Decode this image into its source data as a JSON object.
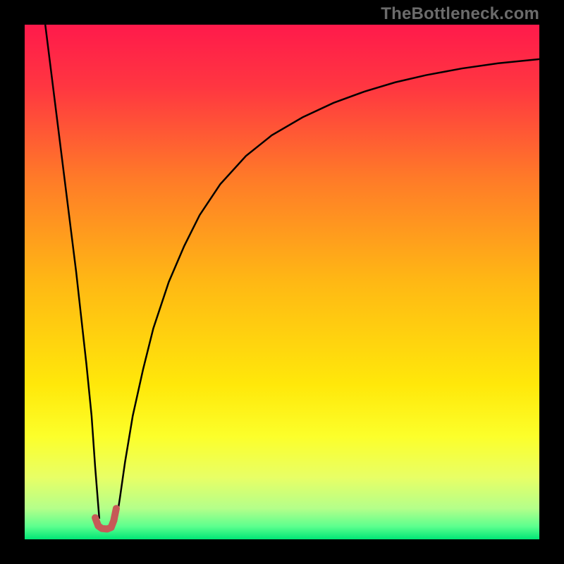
{
  "watermark": "TheBottleneck.com",
  "chart_data": {
    "type": "line",
    "title": "",
    "xlabel": "",
    "ylabel": "",
    "xlim": [
      0,
      100
    ],
    "ylim": [
      0,
      100
    ],
    "grid": false,
    "legend": false,
    "background_gradient": {
      "stops": [
        {
          "offset": 0.0,
          "color": "#ff1a4b"
        },
        {
          "offset": 0.12,
          "color": "#ff3641"
        },
        {
          "offset": 0.3,
          "color": "#ff7b28"
        },
        {
          "offset": 0.5,
          "color": "#ffb814"
        },
        {
          "offset": 0.7,
          "color": "#ffe80a"
        },
        {
          "offset": 0.8,
          "color": "#fcff2a"
        },
        {
          "offset": 0.88,
          "color": "#e8ff66"
        },
        {
          "offset": 0.94,
          "color": "#b4ff8a"
        },
        {
          "offset": 0.975,
          "color": "#5cff8e"
        },
        {
          "offset": 1.0,
          "color": "#00e676"
        }
      ]
    },
    "series": [
      {
        "name": "left-branch",
        "stroke": "#000000",
        "stroke_width": 2.5,
        "x": [
          4.0,
          5.0,
          6.0,
          7.0,
          8.0,
          9.0,
          10.0,
          11.0,
          12.0,
          13.0,
          13.7,
          14.5
        ],
        "y": [
          100.0,
          92.0,
          84.0,
          76.0,
          68.0,
          60.0,
          52.0,
          43.0,
          34.0,
          24.0,
          14.0,
          4.0
        ]
      },
      {
        "name": "right-branch",
        "stroke": "#000000",
        "stroke_width": 2.5,
        "x": [
          17.8,
          18.5,
          19.5,
          21.0,
          23.0,
          25.0,
          28.0,
          31.0,
          34.0,
          38.0,
          43.0,
          48.0,
          54.0,
          60.0,
          66.0,
          72.0,
          78.0,
          85.0,
          92.0,
          100.0
        ],
        "y": [
          3.5,
          8.0,
          15.0,
          24.0,
          33.0,
          41.0,
          50.0,
          57.0,
          63.0,
          69.0,
          74.5,
          78.5,
          82.0,
          84.8,
          87.0,
          88.8,
          90.2,
          91.5,
          92.5,
          93.3
        ]
      },
      {
        "name": "valley-marker",
        "stroke": "#c65a57",
        "stroke_width": 10,
        "linecap": "round",
        "x": [
          13.7,
          14.3,
          15.0,
          16.0,
          16.8,
          17.3,
          17.8
        ],
        "y": [
          4.2,
          2.6,
          2.1,
          2.0,
          2.3,
          3.6,
          6.0
        ]
      }
    ]
  }
}
